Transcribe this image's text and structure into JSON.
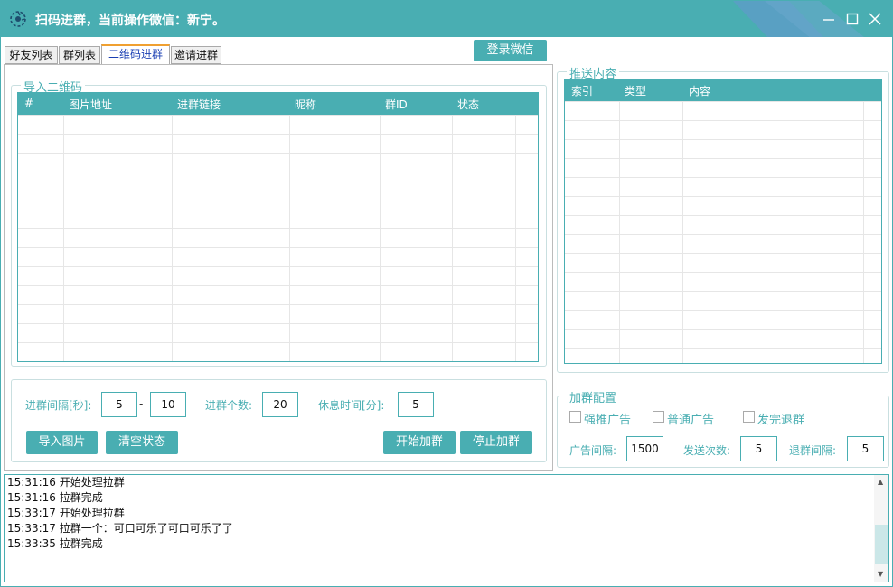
{
  "window": {
    "title": "扫码进群，当前操作微信：新宁。",
    "accent": "#49aeb2"
  },
  "tabs": [
    {
      "label": "好友列表"
    },
    {
      "label": "群列表"
    },
    {
      "label": "二维码进群",
      "active": true
    },
    {
      "label": "邀请进群"
    }
  ],
  "login_button": "登录微信",
  "import_qr": {
    "title": "导入二维码",
    "columns": [
      "#",
      "图片地址",
      "进群链接",
      "昵称",
      "群ID",
      "状态"
    ]
  },
  "settings": {
    "interval_label": "进群间隔[秒]:",
    "interval_min": "5",
    "interval_sep": "-",
    "interval_max": "10",
    "count_label": "进群个数:",
    "count_value": "20",
    "rest_label": "休息时间[分]:",
    "rest_value": "5",
    "import_button": "导入图片",
    "clear_button": "清空状态",
    "start_button": "开始加群",
    "stop_button": "停止加群"
  },
  "push_content": {
    "title": "推送内容",
    "columns": [
      "索引",
      "类型",
      "内容"
    ]
  },
  "join_config": {
    "title": "加群配置",
    "options": [
      {
        "label": "强推广告",
        "checked": false
      },
      {
        "label": "普通广告",
        "checked": false
      },
      {
        "label": "发完退群",
        "checked": false
      }
    ],
    "ad_interval_label": "广告间隔:",
    "ad_interval_value": "1500",
    "send_count_label": "发送次数:",
    "send_count_value": "5",
    "quit_interval_label": "退群间隔:",
    "quit_interval_value": "5"
  },
  "log": [
    "15:31:16 开始处理拉群",
    "15:31:16 拉群完成",
    "15:33:17 开始处理拉群",
    "15:33:17 拉群一个：可口可乐了可口可乐了了",
    "15:33:35 拉群完成"
  ]
}
